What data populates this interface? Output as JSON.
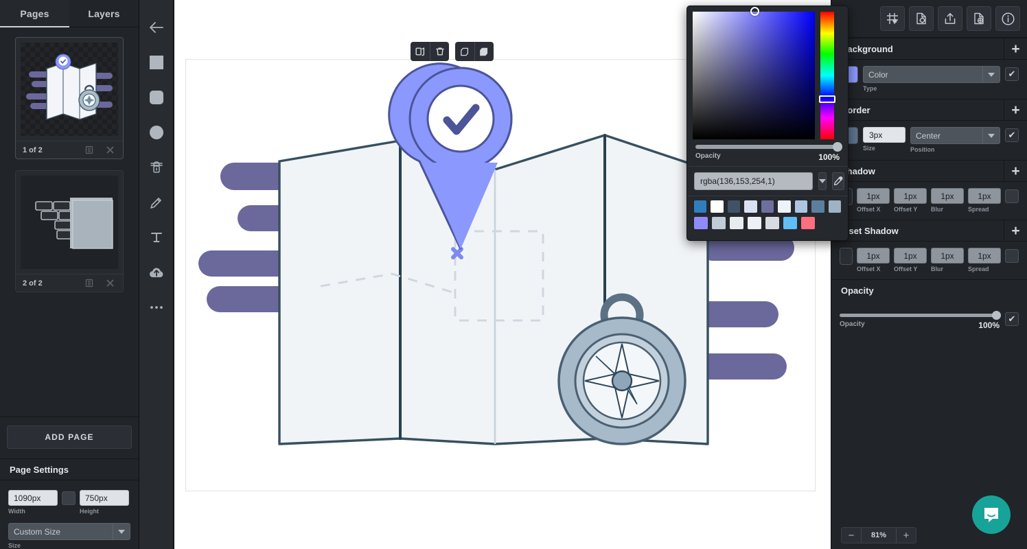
{
  "left_panel": {
    "tabs": [
      {
        "label": "Pages",
        "active": true
      },
      {
        "label": "Layers",
        "active": false
      }
    ],
    "pages": [
      {
        "label": "1 of 2",
        "selected": true
      },
      {
        "label": "2 of 2",
        "selected": false
      }
    ],
    "add_page_label": "ADD PAGE",
    "page_settings": {
      "title": "Page Settings",
      "width_value": "1090px",
      "width_label": "Width",
      "height_value": "750px",
      "height_label": "Height",
      "size_value": "Custom Size",
      "size_label": "Size"
    }
  },
  "tool_rail": {
    "tools": [
      {
        "name": "back-arrow-icon"
      },
      {
        "name": "square-icon"
      },
      {
        "name": "rounded-square-icon"
      },
      {
        "name": "circle-icon"
      },
      {
        "name": "stamp-icon"
      },
      {
        "name": "pencil-icon"
      },
      {
        "name": "text-icon"
      },
      {
        "name": "upload-cloud-icon"
      },
      {
        "name": "more-options-icon"
      }
    ]
  },
  "canvas": {
    "float_toolbar": {
      "groups": [
        [
          {
            "name": "duplicate-icon"
          },
          {
            "name": "delete-icon"
          }
        ],
        [
          {
            "name": "bring-forward-icon"
          },
          {
            "name": "send-backward-icon"
          }
        ]
      ]
    },
    "zoom": {
      "minus_label": "−",
      "value": "81%",
      "plus_label": "+"
    }
  },
  "right_panel": {
    "toolbar_icons": [
      {
        "name": "grid-layout-icon"
      },
      {
        "name": "file-settings-icon"
      },
      {
        "name": "export-share-icon"
      },
      {
        "name": "add-file-icon"
      },
      {
        "name": "info-icon"
      }
    ],
    "sections": [
      {
        "title": "Background",
        "add_label": "+",
        "chip_color": "#8b99fe",
        "type_value": "Color",
        "type_label": "Type",
        "checked": true
      },
      {
        "title": "Border",
        "add_label": "+",
        "chip_color": "#5d7490",
        "size_value": "3px",
        "size_label": "Size",
        "position_value": "Center",
        "position_label": "Position",
        "checked": true
      }
    ],
    "shadow": {
      "title": "Shadow",
      "add_label": "+",
      "chip_color": "#2a2e34",
      "fields": [
        {
          "value": "1px",
          "label": "Offset X"
        },
        {
          "value": "1px",
          "label": "Offset Y"
        },
        {
          "value": "1px",
          "label": "Blur"
        },
        {
          "value": "1px",
          "label": "Spread"
        }
      ]
    },
    "inset_shadow": {
      "title": "Inset Shadow",
      "add_label": "+",
      "chip_color": "#2a2e34",
      "fields": [
        {
          "value": "1px",
          "label": "Offset X"
        },
        {
          "value": "1px",
          "label": "Offset Y"
        },
        {
          "value": "1px",
          "label": "Blur"
        },
        {
          "value": "1px",
          "label": "Spread"
        }
      ]
    },
    "opacity": {
      "title": "Opacity",
      "label": "Opacity",
      "value": "100%"
    }
  },
  "color_picker": {
    "opacity_label": "Opacity",
    "opacity_value": "100%",
    "color_value": "rgba(136,153,254,1)",
    "dropdown_icon": "chevron-down-icon",
    "eyedropper_icon": "eyedropper-icon",
    "swatches_row1": [
      "#2f7ec0",
      "#ffffff",
      "#3f5268",
      "#d9e2f2",
      "#6f6f9e",
      "#eef2f9",
      "#adc5e3",
      "#5c7f9e",
      "#9fb3c4"
    ],
    "swatches_row2": [
      "#8e8cfb",
      "#c0ccd6",
      "#e7ecef",
      "#eef1f3",
      "#d6dce1",
      "#61bdf5",
      "#fb6f7e"
    ]
  },
  "intercom": {
    "icon": "chat-bubble-icon"
  },
  "theme": {
    "accent": "#8b99fe",
    "panel_bg": "#212428",
    "intercom_bg": "#18a399"
  }
}
